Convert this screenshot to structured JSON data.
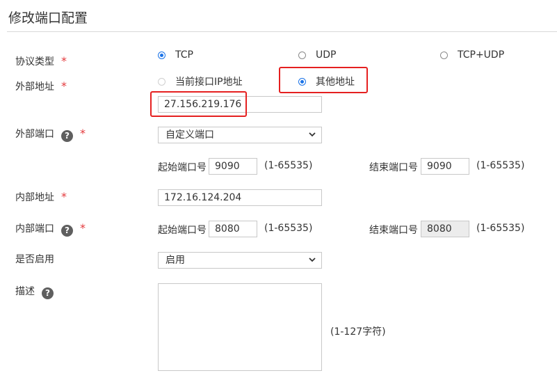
{
  "page": {
    "title": "修改端口配置"
  },
  "colors": {
    "accent": "#1a73e8",
    "required": "#e4393c",
    "highlight_box": "#e52020"
  },
  "form": {
    "protocol": {
      "label": "协议类型",
      "required_mark": "*",
      "options": [
        "TCP",
        "UDP",
        "TCP+UDP"
      ],
      "selected": "TCP"
    },
    "external_address": {
      "label": "外部地址",
      "required_mark": "*",
      "options": [
        "当前接口IP地址",
        "其他地址"
      ],
      "selected": "其他地址",
      "value": "27.156.219.176"
    },
    "external_port": {
      "label": "外部端口",
      "help_icon": "?",
      "required_mark": "*",
      "mode": "自定义端口",
      "start_label": "起始端口号",
      "start_value": "9090",
      "start_range": "(1-65535)",
      "end_label": "结束端口号",
      "end_value": "9090",
      "end_range": "(1-65535)"
    },
    "internal_address": {
      "label": "内部地址",
      "required_mark": "*",
      "value": "172.16.124.204"
    },
    "internal_port": {
      "label": "内部端口",
      "help_icon": "?",
      "required_mark": "*",
      "start_label": "起始端口号",
      "start_value": "8080",
      "start_range": "(1-65535)",
      "end_label": "结束端口号",
      "end_value": "8080",
      "end_range": "(1-65535)"
    },
    "enabled": {
      "label": "是否启用",
      "value": "启用"
    },
    "description": {
      "label": "描述",
      "help_icon": "?",
      "value": "",
      "limit_hint": "(1-127字符)"
    }
  }
}
